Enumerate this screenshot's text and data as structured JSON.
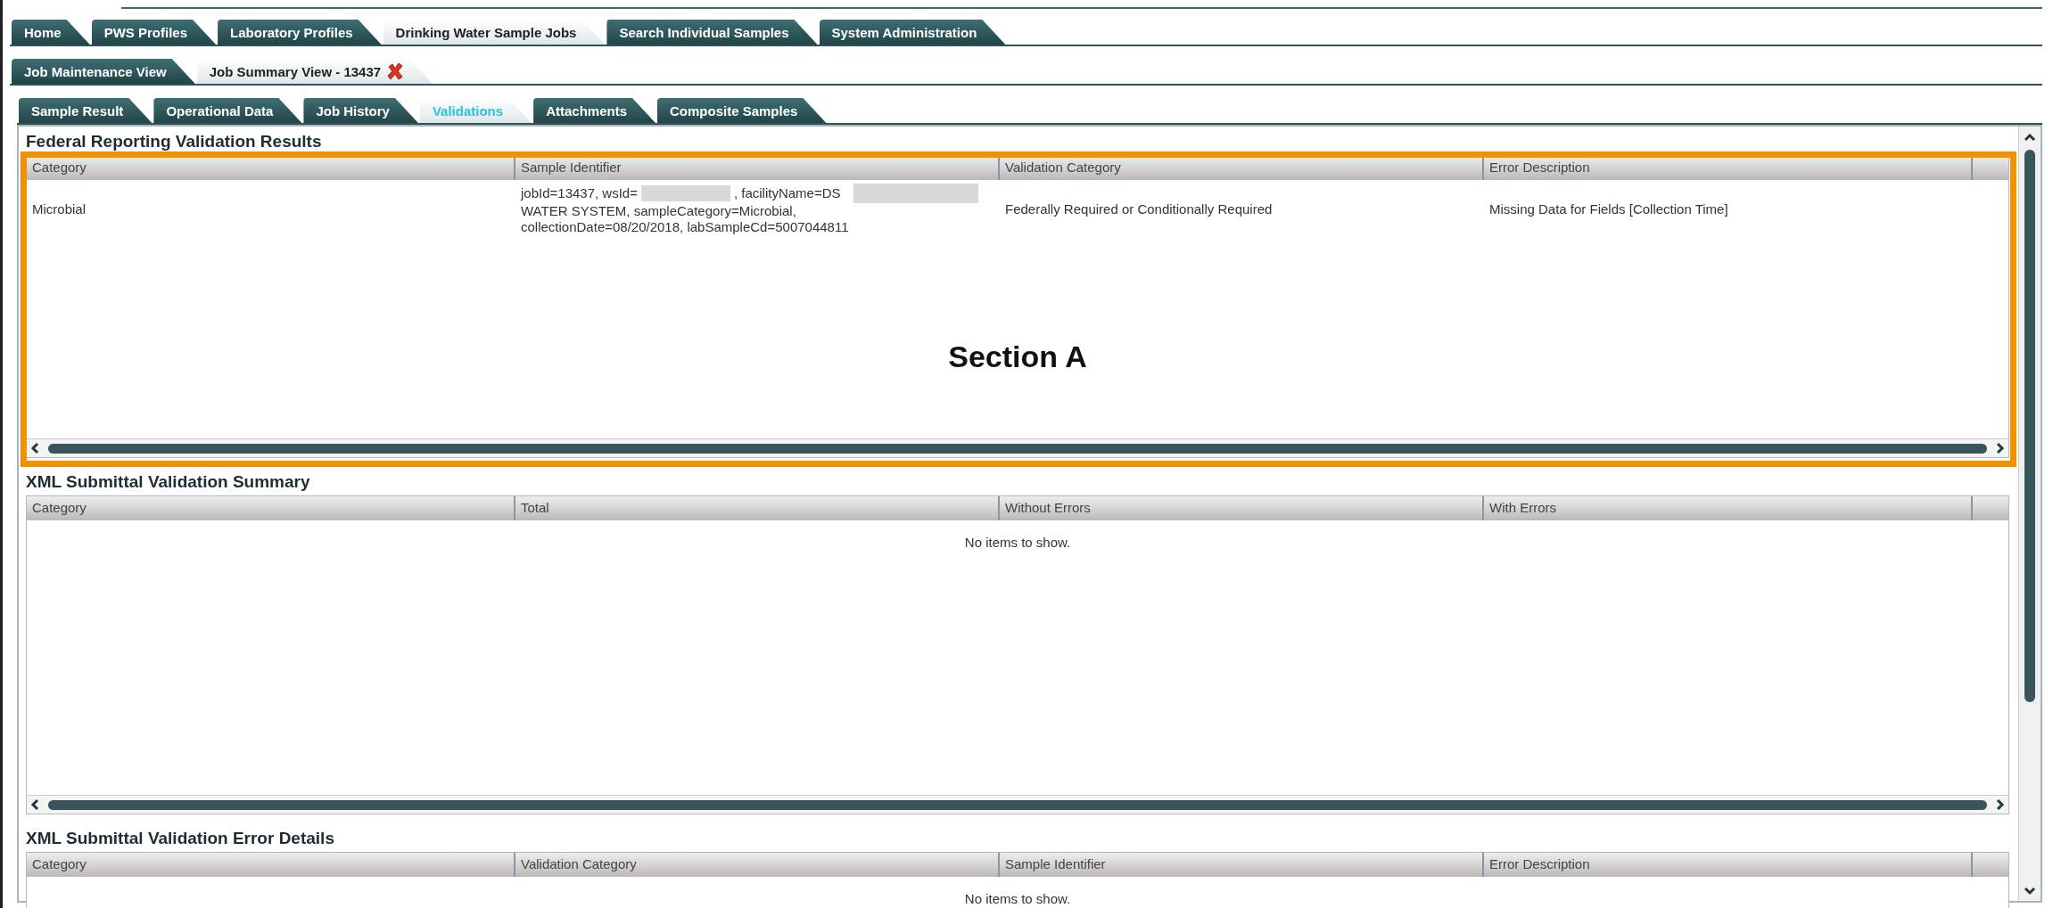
{
  "main_tabs": [
    {
      "label": "Home",
      "selected": false
    },
    {
      "label": "PWS Profiles",
      "selected": false
    },
    {
      "label": "Laboratory Profiles",
      "selected": false
    },
    {
      "label": "Drinking Water Sample Jobs",
      "selected": true
    },
    {
      "label": "Search Individual Samples",
      "selected": false
    },
    {
      "label": "System Administration",
      "selected": false
    }
  ],
  "view_tabs": [
    {
      "label": "Job Maintenance View",
      "selected": false,
      "closable": false
    },
    {
      "label": "Job Summary View - 13437",
      "selected": true,
      "closable": true
    }
  ],
  "detail_tabs": [
    {
      "label": "Sample Result",
      "selected": false
    },
    {
      "label": "Operational Data",
      "selected": false
    },
    {
      "label": "Job History",
      "selected": false
    },
    {
      "label": "Validations",
      "selected": true
    },
    {
      "label": "Attachments",
      "selected": false
    },
    {
      "label": "Composite Samples",
      "selected": false
    }
  ],
  "sections": [
    {
      "title": "Federal Reporting Validation Results",
      "columns": [
        "Category",
        "Sample Identifier",
        "Validation Category",
        "Error Description"
      ],
      "rows": [
        {
          "cells": [
            {
              "lines": [
                [
                  {
                    "kind": "text",
                    "text": "Microbial"
                  }
                ]
              ]
            },
            {
              "lines": [
                [
                  {
                    "kind": "text",
                    "text": "jobId=13437, wsId="
                  },
                  {
                    "kind": "redacted"
                  },
                  {
                    "kind": "text",
                    "text": ", facilityName=DS"
                  },
                  {
                    "kind": "redacted"
                  }
                ],
                [
                  {
                    "kind": "text",
                    "text": "WATER SYSTEM, sampleCategory=Microbial,"
                  }
                ],
                [
                  {
                    "kind": "text",
                    "text": "collectionDate=08/20/2018, labSampleCd=5007044811"
                  }
                ]
              ]
            },
            {
              "lines": [
                [
                  {
                    "kind": "text",
                    "text": "Federally Required or Conditionally Required"
                  }
                ]
              ]
            },
            {
              "lines": [
                [
                  {
                    "kind": "text",
                    "text": "Missing Data for Fields [Collection Time]"
                  }
                ]
              ]
            }
          ]
        }
      ]
    },
    {
      "title": "XML Submittal Validation Summary",
      "columns": [
        "Category",
        "Total",
        "Without Errors",
        "With Errors"
      ],
      "empty_message": "No items to show."
    },
    {
      "title": "XML Submittal Validation Error Details",
      "columns": [
        "Category",
        "Validation Category",
        "Sample Identifier",
        "Error Description"
      ],
      "empty_message": "No items to show."
    }
  ],
  "annotation": {
    "label": "Section A"
  }
}
